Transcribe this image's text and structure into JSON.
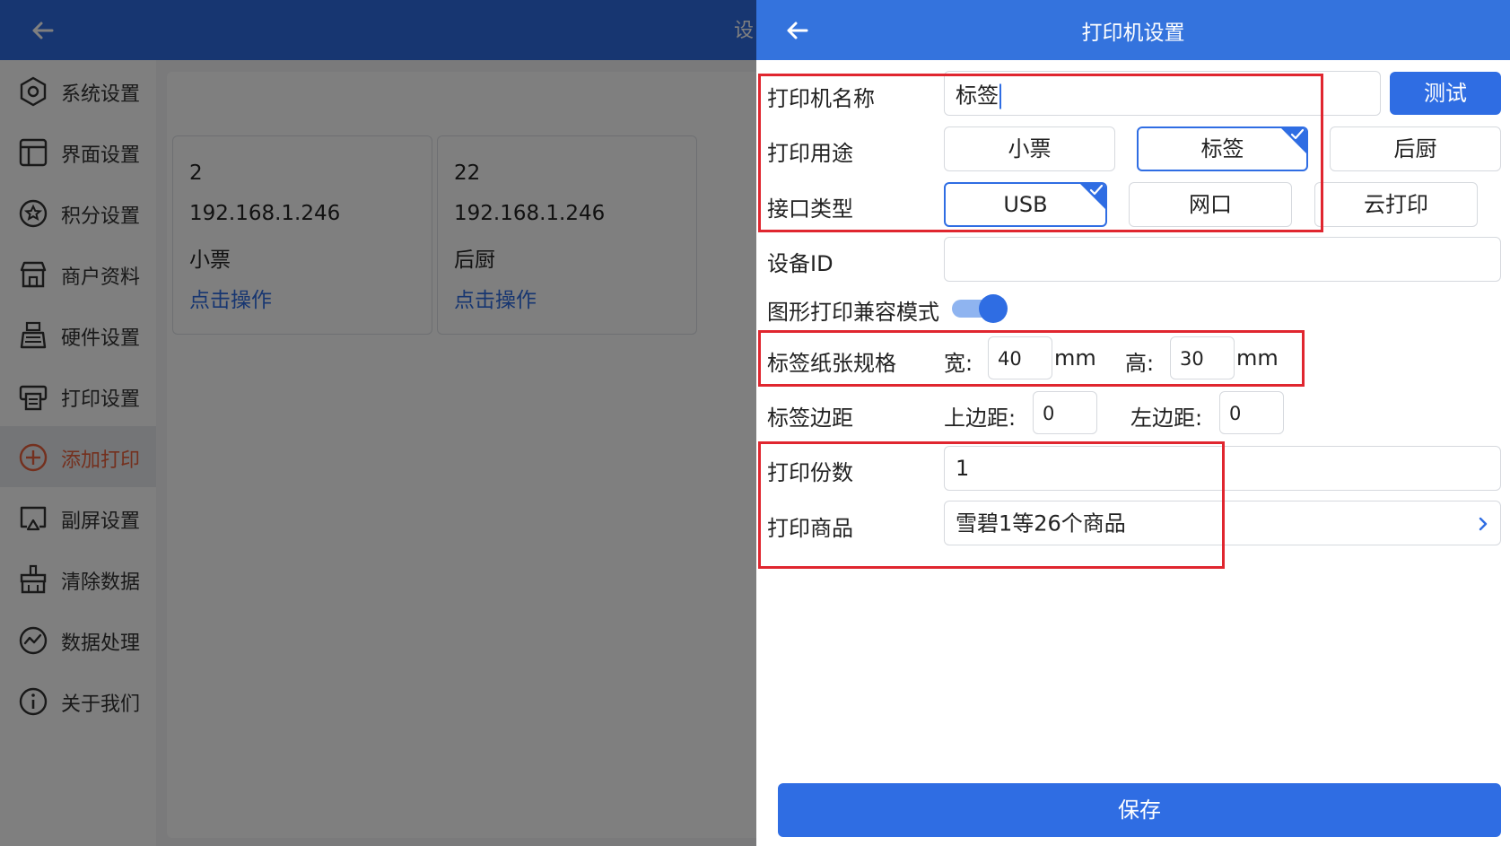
{
  "background": {
    "header_title": "设",
    "sidebar": [
      {
        "label": "系统设置",
        "icon": "hexagon-settings-icon"
      },
      {
        "label": "界面设置",
        "icon": "layout-icon"
      },
      {
        "label": "积分设置",
        "icon": "star-circle-icon"
      },
      {
        "label": "商户资料",
        "icon": "store-icon"
      },
      {
        "label": "硬件设置",
        "icon": "cash-register-icon"
      },
      {
        "label": "打印设置",
        "icon": "printer-icon"
      },
      {
        "label": "添加打印",
        "icon": "plus-circle-icon",
        "active": true
      },
      {
        "label": "副屏设置",
        "icon": "monitor-icon"
      },
      {
        "label": "清除数据",
        "icon": "broom-icon"
      },
      {
        "label": "数据处理",
        "icon": "chart-circle-icon"
      },
      {
        "label": "关于我们",
        "icon": "info-circle-icon"
      }
    ],
    "printers": [
      {
        "name": "2",
        "ip": "192.168.1.246",
        "use": "小票",
        "action": "点击操作"
      },
      {
        "name": "22",
        "ip": "192.168.1.246",
        "use": "后厨",
        "action": "点击操作"
      }
    ]
  },
  "panel": {
    "title": "打印机设置",
    "test_label": "测试",
    "save_label": "保存",
    "printer_name": {
      "label": "打印机名称",
      "value": "标签"
    },
    "usage": {
      "label": "打印用途",
      "options": [
        "小票",
        "标签",
        "后厨"
      ],
      "selected": "标签"
    },
    "interface": {
      "label": "接口类型",
      "options": [
        "USB",
        "网口",
        "云打印"
      ],
      "selected": "USB"
    },
    "device_id": {
      "label": "设备ID",
      "value": ""
    },
    "graphic_mode": {
      "label": "图形打印兼容模式",
      "on": true
    },
    "paper": {
      "label": "标签纸张规格",
      "width_label": "宽:",
      "width": "40",
      "height_label": "高:",
      "height": "30",
      "unit": "mm"
    },
    "margin": {
      "label": "标签边距",
      "top_label": "上边距:",
      "top": "0",
      "left_label": "左边距:",
      "left": "0"
    },
    "copies": {
      "label": "打印份数",
      "value": "1"
    },
    "goods": {
      "label": "打印商品",
      "value": "雪碧1等26个商品"
    }
  },
  "colors": {
    "primary": "#2f6de3",
    "highlight": "#e0262f",
    "active_menu": "#e8603c"
  }
}
